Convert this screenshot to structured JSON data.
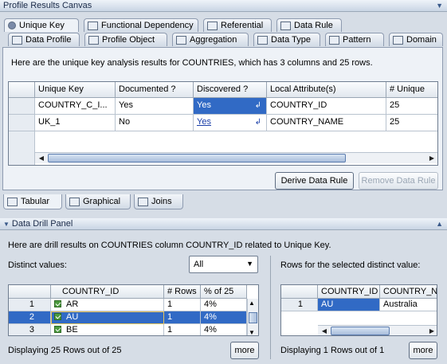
{
  "canvas_title": "Profile Results Canvas",
  "tabs_row1": [
    "Unique Key",
    "Functional Dependency",
    "Referential",
    "Data Rule"
  ],
  "tabs_row2": [
    "Data Profile",
    "Profile Object",
    "Aggregation",
    "Data Type",
    "Pattern",
    "Domain"
  ],
  "summary": "Here are the unique key analysis results for COUNTRIES, which has 3 columns and 25 rows.",
  "uk_table": {
    "headers": [
      "Unique Key",
      "Documented ?",
      "Discovered ?",
      "Local Attribute(s)",
      "# Unique"
    ],
    "rows": [
      [
        "COUNTRY_C_I...",
        "Yes",
        "Yes",
        "COUNTRY_ID",
        "25"
      ],
      [
        "UK_1",
        "No",
        "Yes",
        "COUNTRY_NAME",
        "25"
      ]
    ]
  },
  "buttons": {
    "derive": "Derive Data Rule",
    "remove": "Remove Data Rule",
    "more": "more"
  },
  "bottom_tabs": [
    "Tabular",
    "Graphical",
    "Joins"
  ],
  "drill_title": "Data Drill Panel",
  "drill_desc": "Here are drill results on COUNTRIES column COUNTRY_ID related to Unique Key.",
  "distinct_label": "Distinct values:",
  "distinct_select": "All",
  "rows_label": "Rows for the selected distinct value:",
  "dv_table": {
    "headers": [
      "COUNTRY_ID",
      "# Rows",
      "% of 25"
    ],
    "rows": [
      [
        "1",
        "AR",
        "1",
        "4%"
      ],
      [
        "2",
        "AU",
        "1",
        "4%"
      ],
      [
        "3",
        "BE",
        "1",
        "4%"
      ]
    ]
  },
  "rv_table": {
    "headers": [
      "COUNTRY_ID",
      "COUNTRY_N..."
    ],
    "rows": [
      [
        "1",
        "AU",
        "Australia"
      ]
    ]
  },
  "display_left": "Displaying 25 Rows out of 25",
  "display_right": "Displaying 1 Rows out of 1"
}
